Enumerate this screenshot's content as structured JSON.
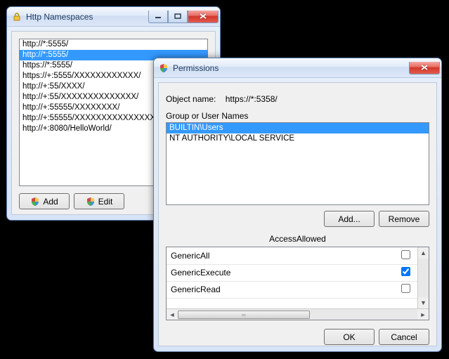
{
  "namespaces_window": {
    "title": "Http Namespaces",
    "items": [
      "http://*:5555/",
      "http://*:5555/",
      "https://*:5555/",
      "https://+:5555/XXXXXXXXXXXX/",
      "http://+:55/XXXX/",
      "http://+:55/XXXXXXXXXXXXXX/",
      "http://+:55555/XXXXXXXX/",
      "http://+:55555/XXXXXXXXXXXXXXXXXXX/",
      "http://+:8080/HelloWorld/"
    ],
    "selected_index": 1,
    "buttons": {
      "add": "Add",
      "edit": "Edit"
    }
  },
  "permissions_window": {
    "title": "Permissions",
    "object_label": "Object name:",
    "object_value": "https://*:5358/",
    "groups_label": "Group or User Names",
    "groups": [
      "BUILTIN\\Users",
      "NT AUTHORITY\\LOCAL SERVICE"
    ],
    "groups_selected_index": 0,
    "buttons": {
      "add": "Add...",
      "remove": "Remove",
      "ok": "OK",
      "cancel": "Cancel"
    },
    "access_header": "AccessAllowed",
    "permissions": [
      {
        "name": "GenericAll",
        "allowed": false
      },
      {
        "name": "GenericExecute",
        "allowed": true
      },
      {
        "name": "GenericRead",
        "allowed": false
      }
    ]
  }
}
